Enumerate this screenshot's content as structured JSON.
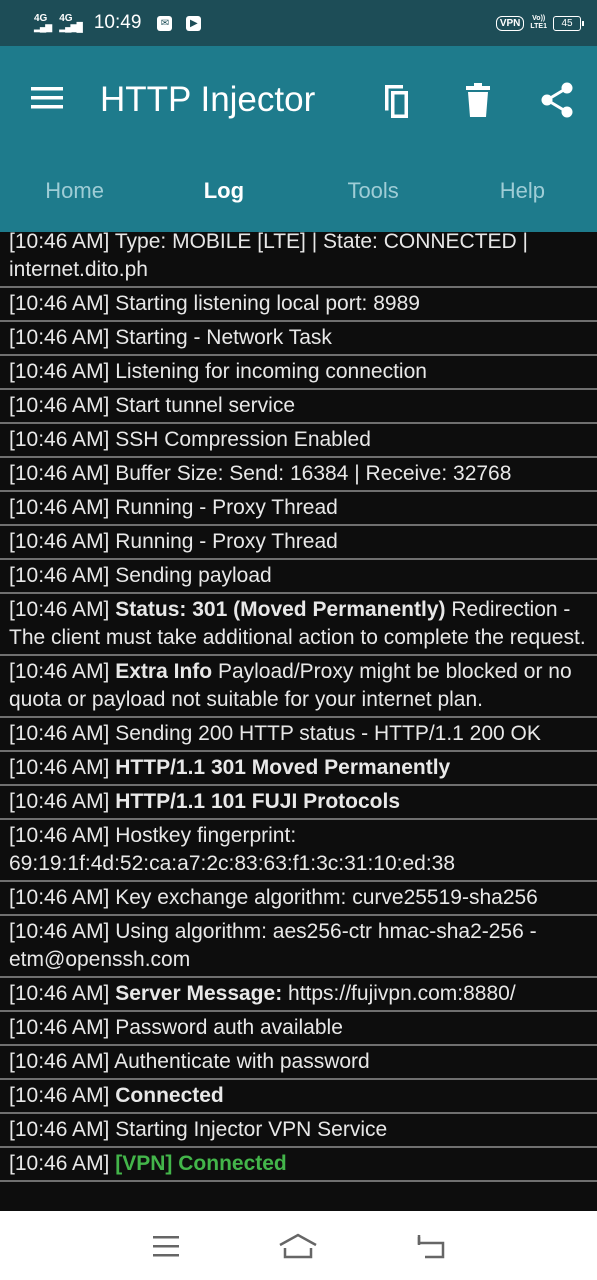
{
  "status_bar": {
    "net1": "4G",
    "net2": "4G",
    "time": "10:49",
    "vpn": "VPN",
    "volte_top": "Vo))",
    "volte_bottom": "LTE1",
    "battery": "45"
  },
  "app": {
    "title": "HTTP Injector",
    "tabs": [
      "Home",
      "Log",
      "Tools",
      "Help"
    ],
    "active_tab": "Log",
    "icons": {
      "menu": "hamburger-menu-icon",
      "copy": "copy-icon",
      "delete": "trash-icon",
      "share": "share-icon"
    }
  },
  "log": [
    {
      "t": "[10:46 AM]",
      "text": "Type: MOBILE [LTE] | State: CONNECTED | internet.dito.ph"
    },
    {
      "t": "[10:46 AM]",
      "text": "Starting listening local port: 8989"
    },
    {
      "t": "[10:46 AM]",
      "text": "Starting - Network Task"
    },
    {
      "t": "[10:46 AM]",
      "text": "Listening for incoming connection"
    },
    {
      "t": "[10:46 AM]",
      "text": "Start tunnel service"
    },
    {
      "t": "[10:46 AM]",
      "text": "SSH Compression Enabled"
    },
    {
      "t": "[10:46 AM]",
      "text": "Buffer Size: Send: 16384 | Receive: 32768"
    },
    {
      "t": "[10:46 AM]",
      "text": "Running - Proxy Thread"
    },
    {
      "t": "[10:46 AM]",
      "text": "Running - Proxy Thread"
    },
    {
      "t": "[10:46 AM]",
      "text": "Sending payload"
    },
    {
      "t": "[10:46 AM]",
      "bold": "Status: 301 (Moved Permanently)",
      "text": "Redirection - The client must take additional action to complete the request."
    },
    {
      "t": "[10:46 AM]",
      "bold": "Extra Info",
      "text": "Payload/Proxy might be blocked or no quota or payload not suitable for your internet plan."
    },
    {
      "t": "[10:46 AM]",
      "text": "Sending 200 HTTP status - HTTP/1.1 200 OK"
    },
    {
      "t": "[10:46 AM]",
      "bold": "HTTP/1.1 301 Moved Permanently"
    },
    {
      "t": "[10:46 AM]",
      "bold": "HTTP/1.1 101 FUJI Protocols"
    },
    {
      "t": "[10:46 AM]",
      "text": "Hostkey fingerprint: 69:19:1f:4d:52:ca:a7:2c:83:63:f1:3c:31:10:ed:38"
    },
    {
      "t": "[10:46 AM]",
      "text": "Key exchange algorithm: curve25519-sha256"
    },
    {
      "t": "[10:46 AM]",
      "text": "Using algorithm: aes256-ctr hmac-sha2-256 -etm@openssh.com"
    },
    {
      "t": "[10:46 AM]",
      "bold": "Server Message:",
      "text": "https://fujivpn.com:8880/"
    },
    {
      "t": "[10:46 AM]",
      "text": "Password auth available"
    },
    {
      "t": "[10:46 AM]",
      "text": "Authenticate with password"
    },
    {
      "t": "[10:46 AM]",
      "bold": "Connected"
    },
    {
      "t": "[10:46 AM]",
      "text": "Starting Injector VPN Service"
    },
    {
      "t": "[10:46 AM]",
      "green": "[VPN] Connected"
    }
  ],
  "colors": {
    "app_bar": "#1e7b8c",
    "status_bar": "#1d4d57",
    "log_bg": "#0d0d0d",
    "vpn_green": "#43b54a"
  }
}
